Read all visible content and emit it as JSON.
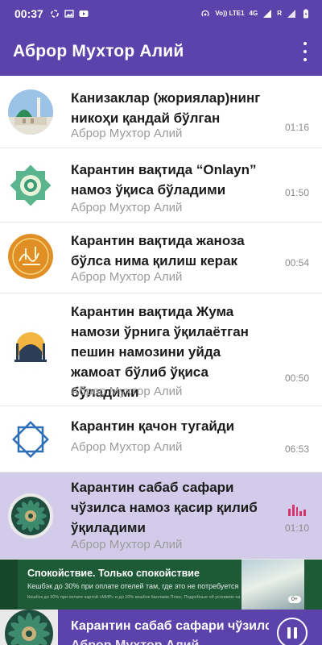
{
  "status_bar": {
    "time": "00:37",
    "network_label": "Vo)) LTE1",
    "signal_label": "4G",
    "secondary_label": "R"
  },
  "app_bar": {
    "title": "Аброр Мухтор Алий"
  },
  "tracks": [
    {
      "title": "Канизаклар (жориялар)нинг никоҳи қандай бўлган",
      "artist": "Аброр Мухтор Алий",
      "duration": "01:16",
      "thumb": "mosque-photo"
    },
    {
      "title": "Карантин вақтида “Onlayn” намоз ўқиса бўладими",
      "artist": "Аброр Мухтор Алий",
      "duration": "01:50",
      "thumb": "green-ornament"
    },
    {
      "title": "Карантин вақтида жаноза бўлса нима қилиш керак",
      "artist": "Аброр Мухтор Алий",
      "duration": "00:54",
      "thumb": "calligraphy-orange"
    },
    {
      "title": "Карантин вақтида Жума намози ўрнига ўқилаётган пешин намозини уйда жамоат бўлиб ўқиса бўладими",
      "artist": "Аброр Мухтор Алий",
      "duration": "00:50",
      "thumb": "mosque-icon"
    },
    {
      "title": "Карантин қачон тугайди",
      "artist": "Аброр Мухтор Алий",
      "duration": "06:53",
      "thumb": "blue-star"
    },
    {
      "title": "Карантин сабаб сафари чўзилса намоз қасир қилиб ўқиладими",
      "artist": "Аброр Мухтор Алий",
      "duration": "01:10",
      "thumb": "dark-mandala",
      "playing": true
    }
  ],
  "ad": {
    "headline": "Спокойствие. Только спокойствие",
    "body": "Кешбэк до 30% при оплате отелей там, где это не потребуется",
    "fine_print": "Кешбэк до 30% при оплате картой «МИР» и до 10% кешбэк баллами Плюс. Подробные об условиях на странице акции.",
    "badge": "0+"
  },
  "mini_player": {
    "title": "Карантин сабаб сафари чўзилса намоз қасир қилиб ўқиладими",
    "artist": "Аброр Мухтор Алий"
  },
  "colors": {
    "primary": "#5b43ab",
    "active_row": "#d3cbea",
    "equalizer": "#d6336c",
    "ad_background": "#1f5a36"
  }
}
